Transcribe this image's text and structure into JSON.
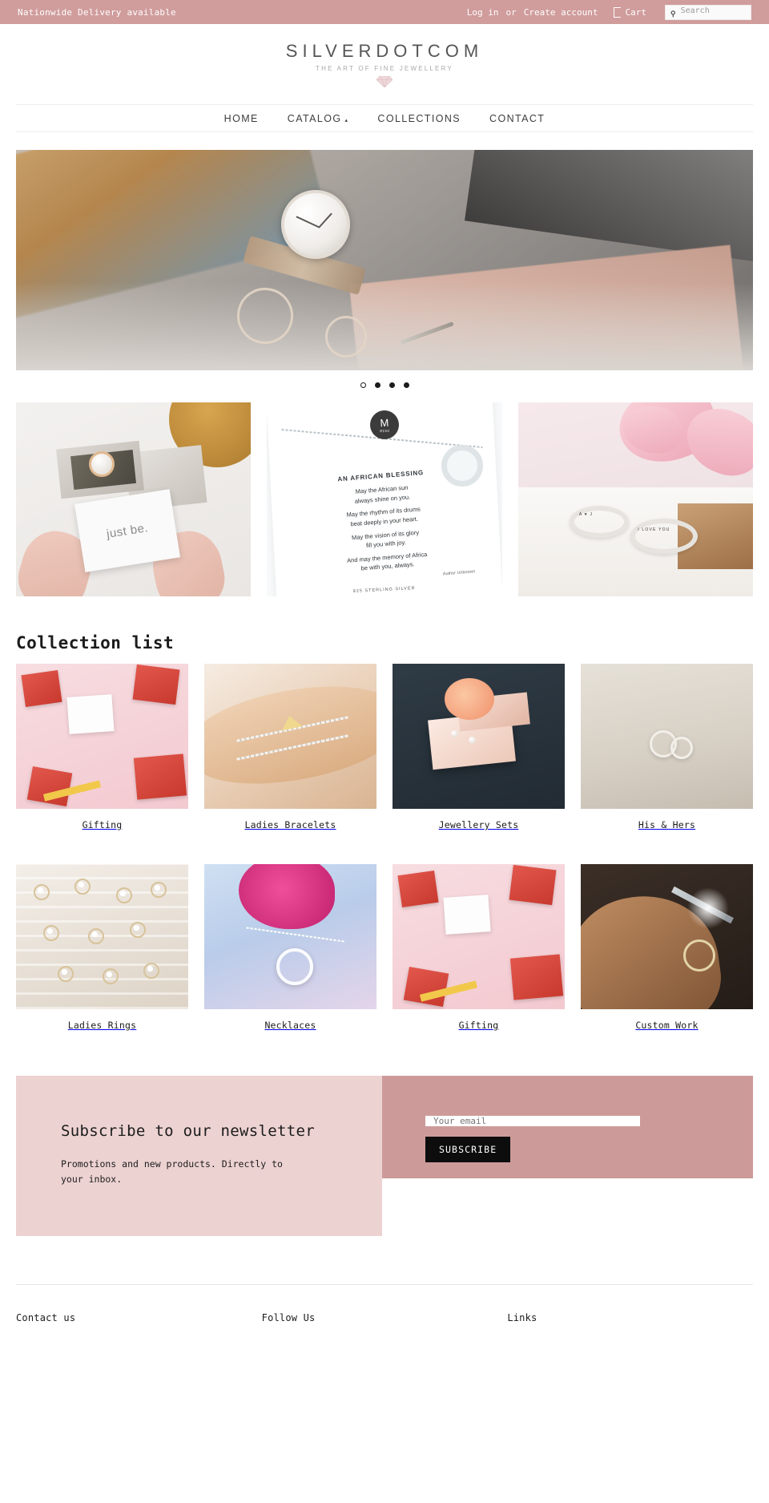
{
  "announcement": {
    "text": "Nationwide Delivery available",
    "login": "Log in",
    "or": "or",
    "create_account": "Create account",
    "cart": "Cart",
    "cart_icon": "cart-icon",
    "search_icon": "search-icon",
    "search_placeholder": "Search",
    "bg_color": "#d09c9c"
  },
  "logo": {
    "title": "SILVERDOTCOM",
    "tagline": "THE ART OF FINE JEWELLERY",
    "emblem_icon": "diamond-icon"
  },
  "nav": {
    "items": [
      {
        "label": "HOME",
        "caret": ""
      },
      {
        "label": "CATALOG",
        "caret": "▴"
      },
      {
        "label": "COLLECTIONS",
        "caret": ""
      },
      {
        "label": "CONTACT",
        "caret": ""
      }
    ]
  },
  "hero": {
    "slide_count": 4,
    "active_slide": 1,
    "alt": "Wristwatch, scarves and jewellery flat lay"
  },
  "tiles": [
    {
      "name": "gift-box-card",
      "card_text": "just be."
    },
    {
      "name": "african-blessing-poster",
      "badge_letter": "M",
      "badge_name": "MIGU",
      "title": "AN AFRICAN BLESSING",
      "lines": [
        "May the African sun",
        "always shine on you.",
        "May the rhythm of its drums",
        "beat deeply in your heart.",
        "May the vision of its glory",
        "fill you with joy.",
        "And may the memory of Africa",
        "be with you, always."
      ],
      "author": "Author Unknown",
      "footer": "925 STERLING SILVER"
    },
    {
      "name": "engraved-rings",
      "stamp_left": "A ♥ J",
      "stamp_right": "I LOVE YOU"
    }
  ],
  "collection_section": {
    "heading": "Collection list",
    "rows": [
      [
        {
          "label": "Gifting",
          "thumb": "th-gifting"
        },
        {
          "label": "Ladies Bracelets",
          "thumb": "th-bracelet"
        },
        {
          "label": "Jewellery Sets",
          "thumb": "th-sets"
        },
        {
          "label": "His & Hers",
          "thumb": "th-hishers"
        }
      ],
      [
        {
          "label": "Ladies Rings",
          "thumb": "th-ladiesrings"
        },
        {
          "label": "Necklaces",
          "thumb": "th-necklaces"
        },
        {
          "label": "Gifting",
          "thumb": "th-gifting"
        },
        {
          "label": "Custom Work",
          "thumb": "th-custom"
        }
      ]
    ]
  },
  "newsletter": {
    "title": "Subscribe to our newsletter",
    "subtitle": "Promotions and new products. Directly to your inbox.",
    "input_placeholder": "Your email",
    "input_value": "",
    "button": "SUBSCRIBE",
    "left_bg": "#edd2d2",
    "right_bg": "#cd9a9a"
  },
  "footer": {
    "columns": [
      {
        "heading": "Contact us",
        "line": ""
      },
      {
        "heading": "Follow Us",
        "line": ""
      },
      {
        "heading": "Links",
        "line": ""
      }
    ]
  }
}
